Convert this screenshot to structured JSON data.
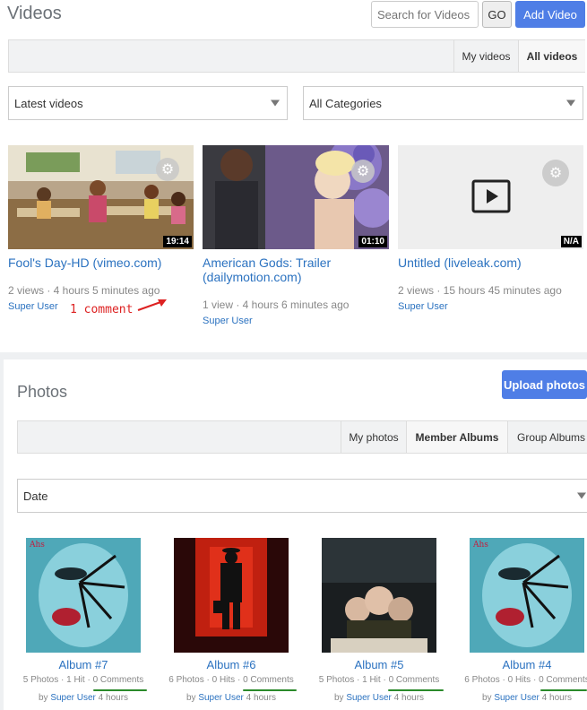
{
  "videos": {
    "title": "Videos",
    "search_placeholder": "Search for Videos",
    "go_label": "GO",
    "add_label": "Add Video",
    "tabs": [
      {
        "label": "My videos"
      },
      {
        "label": "All videos",
        "active": true
      }
    ],
    "sort_select": "Latest videos",
    "category_select": "All Categories",
    "items": [
      {
        "title": "Fool's Day-HD (vimeo.com)",
        "duration": "19:14",
        "meta": "2 views · 4 hours 5 minutes ago",
        "user": "Super User"
      },
      {
        "title": "American Gods: Trailer (dailymotion.com)",
        "duration": "01:10",
        "meta": "1 view · 4 hours 6 minutes ago",
        "user": "Super User"
      },
      {
        "title": "Untitled (liveleak.com)",
        "duration": "N/A",
        "meta": "2 views · 15 hours 45 minutes ago",
        "user": "Super User"
      }
    ],
    "annotation": "1 comment",
    "annotation_color": "#dd2222"
  },
  "photos": {
    "title": "Photos",
    "upload_label": "Upload photos",
    "tabs": [
      {
        "label": "My photos"
      },
      {
        "label": "Member Albums",
        "active": true
      },
      {
        "label": "Group Albums"
      }
    ],
    "sort_select": "Date",
    "albums": [
      {
        "name": "Album #7",
        "photos": "5 Photos",
        "hits": "1 Hit",
        "comments": "0 Comments",
        "by": "by",
        "user": "Super User",
        "time": "4 hours"
      },
      {
        "name": "Album #6",
        "photos": "6 Photos",
        "hits": "0 Hits",
        "comments": "0 Comments",
        "by": "by",
        "user": "Super User",
        "time": "4 hours"
      },
      {
        "name": "Album #5",
        "photos": "5 Photos",
        "hits": "1 Hit",
        "comments": "0 Comments",
        "by": "by",
        "user": "Super User",
        "time": "4 hours"
      },
      {
        "name": "Album #4",
        "photos": "6 Photos",
        "hits": "0 Hits",
        "comments": "0 Comments",
        "by": "by",
        "user": "Super User",
        "time": "4 hours"
      }
    ],
    "underline_color": "#2a8a2a"
  },
  "colors": {
    "accent": "#4f7ee6",
    "link": "#2b72c0"
  }
}
